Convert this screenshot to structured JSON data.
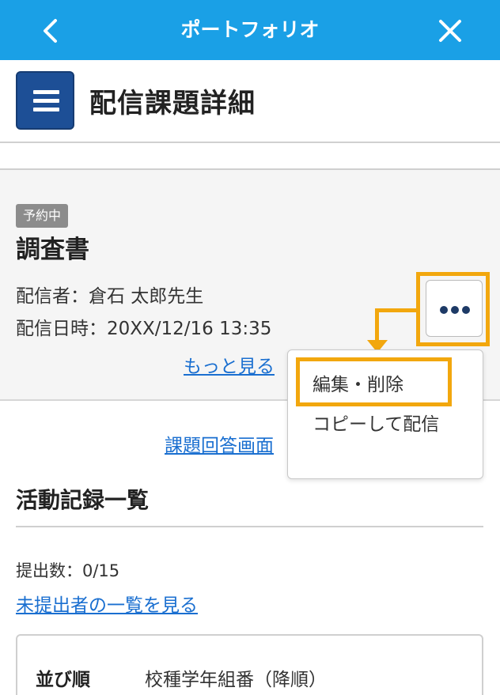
{
  "topbar": {
    "title": "ポートフォリオ",
    "back_icon": "chevron-left-icon",
    "close_icon": "close-icon",
    "color": "#1aa0e6"
  },
  "header": {
    "menu_icon": "hamburger-menu-icon",
    "title": "配信課題詳細",
    "menu_color": "#1d4f96"
  },
  "card": {
    "badge": "予約中",
    "title": "調査書",
    "sender": "配信者：倉石 太郎先生",
    "datetime": "配信日時：20XX/12/16 13:35",
    "more_link": "もっと見る",
    "more_icon": "more-horizontal-icon"
  },
  "dropdown": {
    "items": [
      {
        "label": "編集・削除"
      },
      {
        "label": "コピーして配信"
      }
    ]
  },
  "answer_link": "課題回答画面",
  "activity": {
    "title": "活動記録一覧",
    "count": "提出数：0/15",
    "unsubmitted_link": "未提出者の一覧を見る"
  },
  "sort": {
    "label": "並び順",
    "value": "校種学年組番（降順）"
  },
  "colors": {
    "highlight": "#f2a70e",
    "link": "#1a6fd0"
  }
}
